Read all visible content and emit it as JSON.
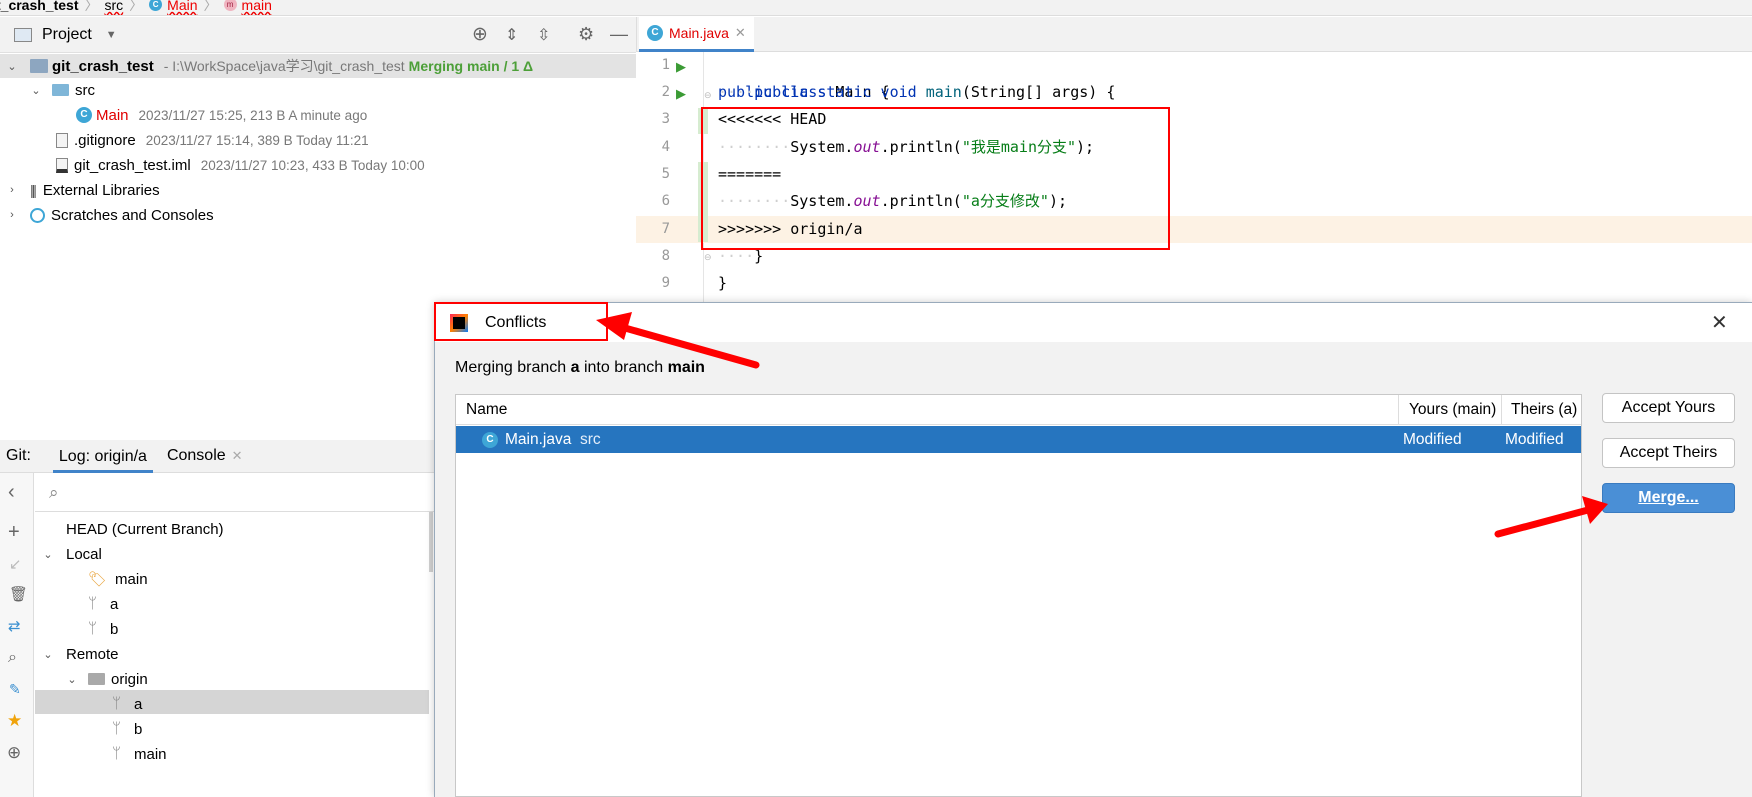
{
  "breadcrumb": {
    "project": "t_crash_test",
    "src": "src",
    "cls": "Main",
    "method": "main"
  },
  "project_panel": {
    "title": "Project",
    "root": {
      "name": "git_crash_test",
      "path": "- I:\\WorkSpace\\java学习\\git_crash_test",
      "status": "Merging main / 1 Δ"
    },
    "src": "src",
    "main": {
      "name": "Main",
      "meta": "2023/11/27 15:25, 213 B A minute ago"
    },
    "gitignore": {
      "name": ".gitignore",
      "meta": "2023/11/27 15:14, 389 B Today 11:21"
    },
    "iml": {
      "name": "git_crash_test.iml",
      "meta": "2023/11/27 10:23, 433 B Today 10:00"
    },
    "ext_libs": "External Libraries",
    "scratches": "Scratches and Consoles"
  },
  "editor": {
    "tab": "Main.java",
    "line_numbers": [
      "1",
      "2",
      "3",
      "4",
      "5",
      "6",
      "7",
      "8",
      "9"
    ],
    "l1": {
      "a": "public",
      "b": " class ",
      "c": "Main {"
    },
    "l2": {
      "dots": "····",
      "a": "public",
      "b": " static",
      "c": " void",
      "d": " main",
      "e": "(String[] args) {"
    },
    "l3": "<<<<<<< HEAD",
    "l4": {
      "dots": "········",
      "a": "System.",
      "b": "out",
      "c": ".println(",
      "d": "\"我是main分支\"",
      "e": ");"
    },
    "l5": "=======",
    "l6": {
      "dots": "········",
      "a": "System.",
      "b": "out",
      "c": ".println(",
      "d": "\"a分支修改\"",
      "e": ");"
    },
    "l7": ">>>>>>> origin/a",
    "l8": {
      "dots": "····",
      "a": "}"
    },
    "l9": "}"
  },
  "git_panel": {
    "label": "Git:",
    "tab_log": "Log: origin/a",
    "tab_console": "Console",
    "head": "HEAD (Current Branch)",
    "local": "Local",
    "local_branches": [
      "main",
      "a",
      "b"
    ],
    "remote": "Remote",
    "origin": "origin",
    "remote_branches": [
      "a",
      "b",
      "main"
    ]
  },
  "dialog": {
    "title": "Conflicts",
    "msg_prefix": "Merging branch ",
    "msg_src": "a",
    "msg_mid": " into branch ",
    "msg_dst": "main",
    "columns": {
      "name": "Name",
      "yours": "Yours (main)",
      "theirs": "Theirs (a)"
    },
    "row": {
      "file": "Main.java",
      "dir": "src",
      "yours": "Modified",
      "theirs": "Modified"
    },
    "accept_yours": "Accept Yours",
    "accept_theirs": "Accept Theirs",
    "merge": "Merge..."
  },
  "colors": {
    "selection": "#2675bf",
    "annotation": "#ff0000",
    "accent_green": "#4c9f38"
  }
}
